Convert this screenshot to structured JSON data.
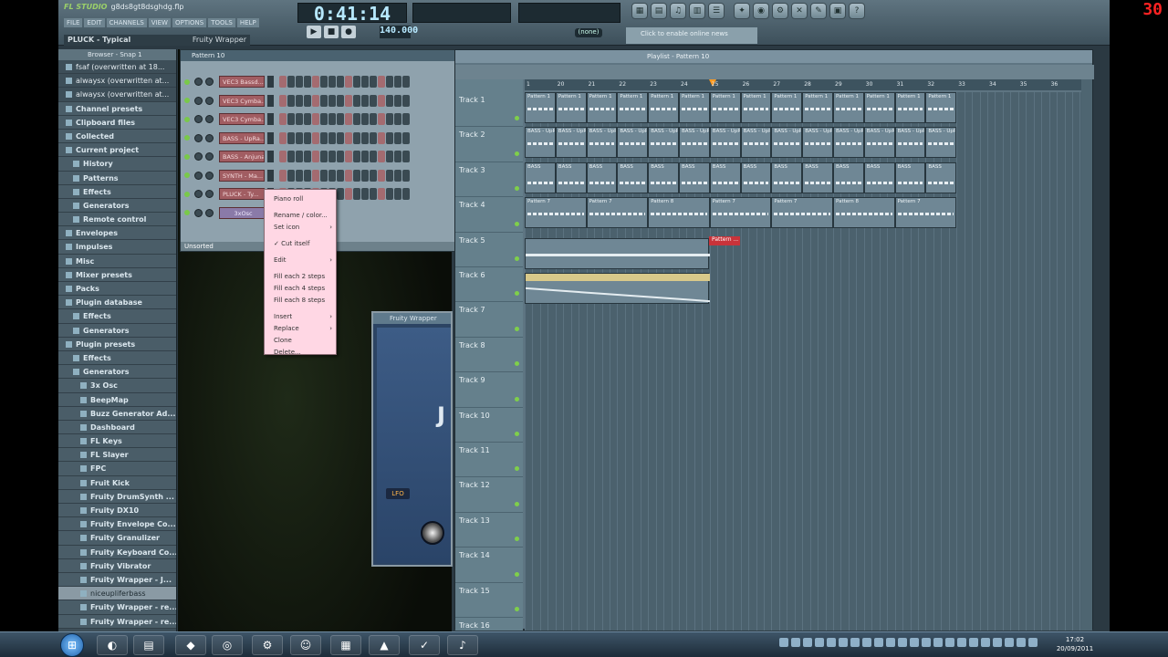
{
  "app": {
    "title_logo": "FL STUDIO",
    "file": "g8ds8gt8dsghdg.flp",
    "menu": [
      "FILE",
      "EDIT",
      "CHANNELS",
      "VIEW",
      "OPTIONS",
      "TOOLS",
      "HELP"
    ],
    "hint_left": "PLUCK - Typical",
    "hint_right": "Fruity Wrapper",
    "time": "0:41:14",
    "tempo": "140.000",
    "pattern_box": "(none)",
    "online": "Click to enable online news"
  },
  "right_counter": "30",
  "browser": {
    "header": "Browser - Snap 1",
    "items": [
      {
        "label": "fsaf (overwritten at 18...",
        "kind": "file"
      },
      {
        "label": "alwaysx (overwritten at...",
        "kind": "file"
      },
      {
        "label": "alwaysx (overwritten at...",
        "kind": "file"
      },
      {
        "label": "Channel presets",
        "kind": "folder"
      },
      {
        "label": "Clipboard files",
        "kind": "folder"
      },
      {
        "label": "Collected",
        "kind": "folder"
      },
      {
        "label": "Current project",
        "kind": "folder"
      },
      {
        "label": "History",
        "kind": "folder"
      },
      {
        "label": "Patterns",
        "kind": "folder"
      },
      {
        "label": "Effects",
        "kind": "folder"
      },
      {
        "label": "Generators",
        "kind": "folder"
      },
      {
        "label": "Remote control",
        "kind": "folder"
      },
      {
        "label": "Envelopes",
        "kind": "folder"
      },
      {
        "label": "Impulses",
        "kind": "folder"
      },
      {
        "label": "Misc",
        "kind": "folder"
      },
      {
        "label": "Mixer presets",
        "kind": "folder"
      },
      {
        "label": "Packs",
        "kind": "folder"
      },
      {
        "label": "Plugin database",
        "kind": "folder"
      },
      {
        "label": "Effects",
        "kind": "folder"
      },
      {
        "label": "Generators",
        "kind": "folder"
      },
      {
        "label": "Plugin presets",
        "kind": "folder"
      },
      {
        "label": "Effects",
        "kind": "folder"
      },
      {
        "label": "Generators",
        "kind": "folder"
      },
      {
        "label": "3x Osc",
        "kind": "folder"
      },
      {
        "label": "BeepMap",
        "kind": "folder"
      },
      {
        "label": "Buzz Generator Ad...",
        "kind": "folder"
      },
      {
        "label": "Dashboard",
        "kind": "folder"
      },
      {
        "label": "FL Keys",
        "kind": "folder"
      },
      {
        "label": "FL Slayer",
        "kind": "folder"
      },
      {
        "label": "FPC",
        "kind": "folder"
      },
      {
        "label": "Fruit Kick",
        "kind": "folder"
      },
      {
        "label": "Fruity DrumSynth ...",
        "kind": "folder"
      },
      {
        "label": "Fruity DX10",
        "kind": "folder"
      },
      {
        "label": "Fruity Envelope Co...",
        "kind": "folder"
      },
      {
        "label": "Fruity Granulizer",
        "kind": "folder"
      },
      {
        "label": "Fruity Keyboard Co...",
        "kind": "folder"
      },
      {
        "label": "Fruity Vibrator",
        "kind": "folder"
      },
      {
        "label": "Fruity Wrapper - J...",
        "kind": "folder"
      },
      {
        "label": "niceupliferbass",
        "kind": "highlight"
      },
      {
        "label": "Fruity Wrapper - re...",
        "kind": "folder"
      },
      {
        "label": "Fruity Wrapper - re...",
        "kind": "folder"
      }
    ]
  },
  "channel_rack": {
    "title": "Pattern 10",
    "footer": "Unsorted",
    "channels": [
      "VEC3 Bassd...",
      "VEC3 Cymba...",
      "VEC3 Cymba...",
      "BASS - UpRa...",
      "BASS - Anjuna",
      "SYNTH - Ma...",
      "PLUCK - Ty...",
      "3xOsc"
    ]
  },
  "context_menu": {
    "items": [
      {
        "label": "Piano roll",
        "arrow": ""
      },
      {
        "label": "Rename / color...",
        "arrow": "",
        "gap": true
      },
      {
        "label": "Set icon",
        "arrow": "›"
      },
      {
        "label": "✓ Cut itself",
        "arrow": "",
        "gap": true
      },
      {
        "label": "Edit",
        "arrow": "›",
        "gap": true
      },
      {
        "label": "Fill each 2 steps",
        "arrow": "",
        "gap": true
      },
      {
        "label": "Fill each 4 steps",
        "arrow": ""
      },
      {
        "label": "Fill each 8 steps",
        "arrow": ""
      },
      {
        "label": "Insert",
        "arrow": "›",
        "gap": true
      },
      {
        "label": "Replace",
        "arrow": "›"
      },
      {
        "label": "Clone",
        "arrow": ""
      },
      {
        "label": "Delete...",
        "arrow": ""
      }
    ]
  },
  "wrapper": {
    "title": "Fruity Wrapper",
    "lfo": "LFO",
    "big": "J"
  },
  "playlist": {
    "title": "Playlist - Pattern 10",
    "tracks": [
      "Track 1",
      "Track 2",
      "Track 3",
      "Track 4",
      "Track 5",
      "Track 6",
      "Track 7",
      "Track 8",
      "Track 9",
      "Track 10",
      "Track 11",
      "Track 12",
      "Track 13",
      "Track 14",
      "Track 15",
      "Track 16"
    ],
    "ruler": [
      "1",
      "20",
      "21",
      "22",
      "23",
      "24",
      "25",
      "26",
      "27",
      "28",
      "29",
      "30",
      "31",
      "32",
      "33",
      "34",
      "35",
      "36",
      "37"
    ],
    "row_labels": [
      "Pattern 1",
      "BASS - UpRange CYF",
      "BASS",
      "Pattern 7",
      "Pattern 8"
    ],
    "red_pattern": "Pattern ..."
  },
  "taskbar": {
    "time": "17:02",
    "date": "20/09/2011"
  }
}
